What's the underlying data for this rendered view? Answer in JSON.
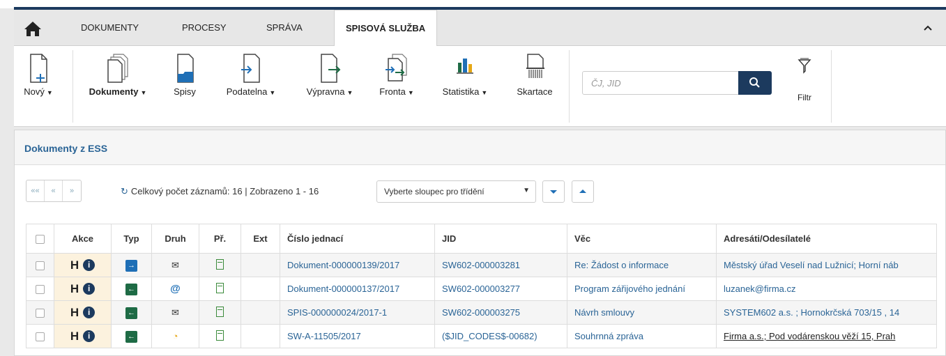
{
  "nav": {
    "tabs": [
      {
        "label": "DOKUMENTY"
      },
      {
        "label": "PROCESY"
      },
      {
        "label": "SPRÁVA"
      },
      {
        "label": "SPISOVÁ SLUŽBA"
      }
    ]
  },
  "toolbar": {
    "new": "Nový",
    "dokumenty": "Dokumenty",
    "spisy": "Spisy",
    "podatelna": "Podatelna",
    "vypravna": "Výpravna",
    "fronta": "Fronta",
    "statistika": "Statistika",
    "skartace": "Skartace",
    "search_placeholder": "ČJ, JID",
    "filter": "Filtr"
  },
  "panel": {
    "title": "Dokumenty z ESS",
    "pager": [
      "««",
      "«",
      "»"
    ],
    "count_text": "Celkový počet záznamů: 16 | Zobrazeno 1 - 16",
    "sort_placeholder": "Vyberte sloupec pro třídění"
  },
  "table": {
    "headers": [
      "Akce",
      "Typ",
      "Druh",
      "Př.",
      "Ext",
      "Číslo jednací",
      "JID",
      "Věc",
      "Adresáti/Odesílatelé"
    ],
    "rows": [
      {
        "h": "H",
        "cislo": "Dokument-000000139/2017",
        "jid": "SW602-000003281",
        "vec": "Re: Žádost o informace",
        "adresati": "Městský úřad Veselí nad Lužnicí; Horní náb"
      },
      {
        "h": "H",
        "cislo": "Dokument-000000137/2017",
        "jid": "SW602-000003277",
        "vec": "Program zářijového jednání",
        "adresati": "luzanek@firma.cz"
      },
      {
        "h": "H",
        "cislo": "SPIS-000000024/2017-1",
        "jid": "SW602-000003275",
        "vec": "Návrh smlouvy",
        "adresati": "SYSTEM602 a.s. ; Hornokrčská 703/15 , 14"
      },
      {
        "h": "H",
        "cislo": "SW-A-11505/2017",
        "jid": "($JID_CODES$-00682)",
        "vec": "Souhrnná zpráva",
        "adresati": "Firma a.s.; Pod vodárenskou věží 15, Prah"
      }
    ]
  }
}
